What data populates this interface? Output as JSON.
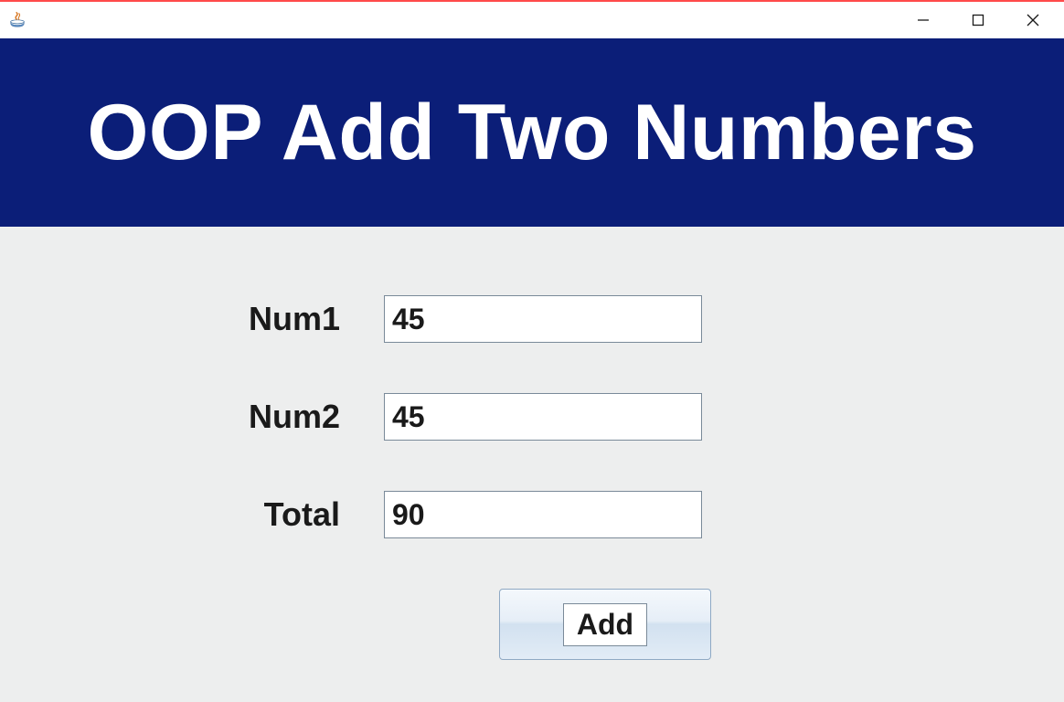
{
  "window": {
    "title": ""
  },
  "header": {
    "title": "OOP Add Two Numbers"
  },
  "form": {
    "num1": {
      "label": "Num1",
      "value": "45"
    },
    "num2": {
      "label": "Num2",
      "value": "45"
    },
    "total": {
      "label": "Total",
      "value": "90"
    },
    "add_button_label": "Add"
  }
}
